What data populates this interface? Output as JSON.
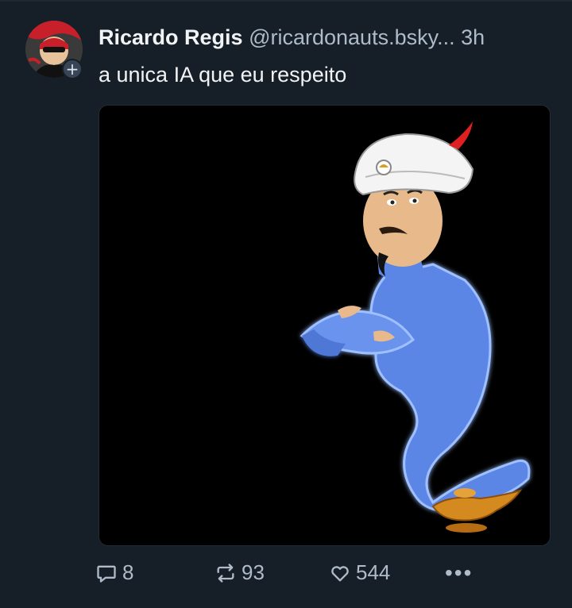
{
  "post": {
    "author_name": "Ricardo Regis",
    "author_handle": "@ricardonauts.bsky...",
    "time": "3h",
    "text": "a unica IA que eu respeito",
    "follow_badge": "+",
    "image_icon": "genie-akinator-illustration",
    "counts": {
      "replies": "8",
      "reposts": "93",
      "likes": "544"
    },
    "more_label": "•••"
  },
  "colors": {
    "background": "#161e27",
    "text_primary": "#f1f3f5",
    "text_secondary": "#aebbc9"
  }
}
